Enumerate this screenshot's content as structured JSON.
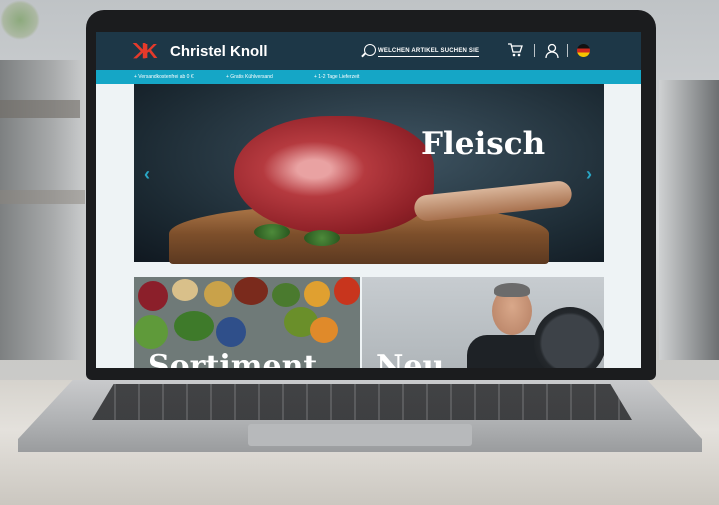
{
  "header": {
    "logo_mark": "ꓘK",
    "logo_text": "Christel Knoll",
    "search_label": "WELCHEN ARTIKEL SUCHEN SIE"
  },
  "benefits": [
    "+ Versandkostenfrei ab 0 €",
    "+ Gratis Kühlversand",
    "+ 1-2 Tage Lieferzeit"
  ],
  "hero": {
    "title": "Fleisch",
    "prev_arrow": "‹",
    "next_arrow": "›"
  },
  "tiles": {
    "left_title": "Sortiment",
    "right_title": "Neu"
  },
  "colors": {
    "header_bg": "#1d3747",
    "accent_bar": "#15a6c6",
    "logo_red": "#e53a2b",
    "arrow": "#2aa6c5"
  }
}
